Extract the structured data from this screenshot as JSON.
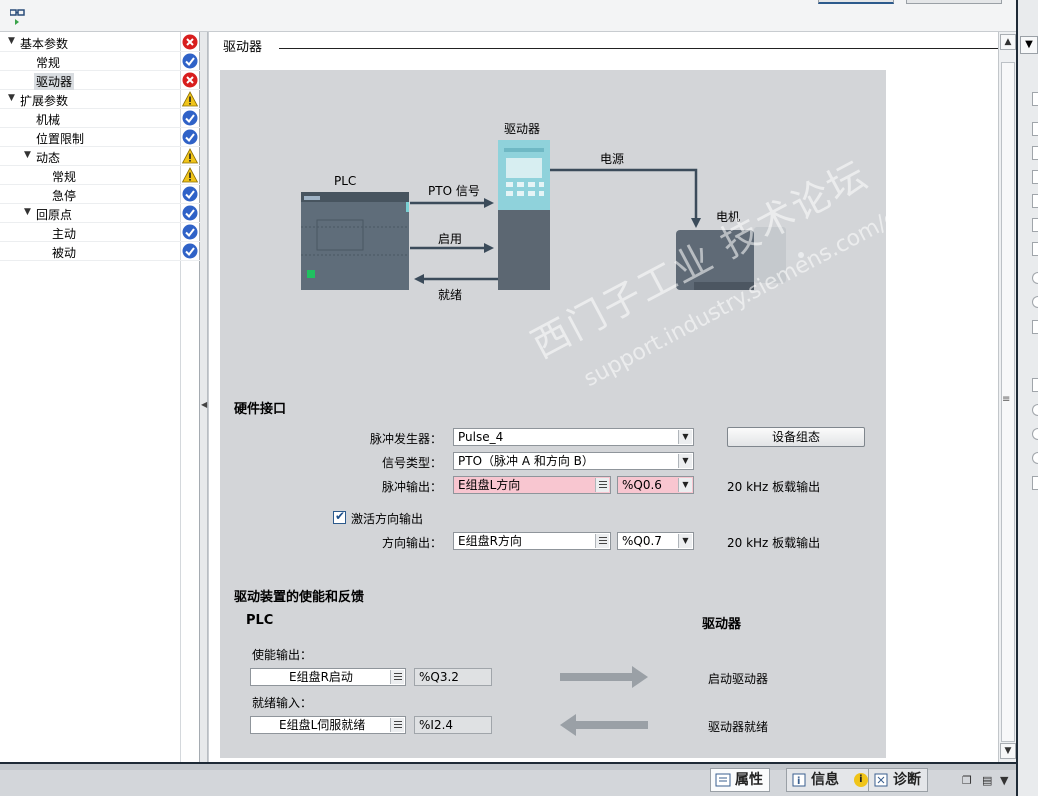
{
  "tree": {
    "items": [
      {
        "label": "基本参数",
        "status": "error"
      },
      {
        "label": "常规",
        "status": "ok"
      },
      {
        "label": "驱动器",
        "status": "error"
      },
      {
        "label": "扩展参数",
        "status": "warning"
      },
      {
        "label": "机械",
        "status": "ok"
      },
      {
        "label": "位置限制",
        "status": "ok"
      },
      {
        "label": "动态",
        "status": "warning"
      },
      {
        "label": "常规",
        "status": "warning"
      },
      {
        "label": "急停",
        "status": "ok"
      },
      {
        "label": "回原点",
        "status": "ok"
      },
      {
        "label": "主动",
        "status": "ok"
      },
      {
        "label": "被动",
        "status": "ok"
      }
    ]
  },
  "main": {
    "section_title": "驱动器"
  },
  "diagram": {
    "plc_label": "PLC",
    "drive_label": "驱动器",
    "power_label": "电源",
    "motor_label": "电机",
    "pto_label": "PTO 信号",
    "enable_label": "启用",
    "ready_label": "就绪"
  },
  "watermark": {
    "line1": "西门子工业  技术论坛",
    "line2": "support.industry.siemens.com/cs"
  },
  "hardware": {
    "heading": "硬件接口",
    "pulse_gen_label": "脉冲发生器：",
    "pulse_gen_value": "Pulse_4",
    "device_config_button": "设备组态",
    "signal_type_label": "信号类型：",
    "signal_type_value": "PTO（脉冲 A 和方向 B）",
    "pulse_out_label": "脉冲输出：",
    "pulse_out_tag": "E组盘L方向",
    "pulse_out_addr": "%Q0.6",
    "pulse_out_note": "20 kHz 板载输出",
    "activate_dir_label": "激活方向输出",
    "activate_dir_checked": true,
    "dir_out_label": "方向输出：",
    "dir_out_tag": "E组盘R方向",
    "dir_out_addr": "%Q0.7",
    "dir_out_note": "20 kHz 板载输出"
  },
  "enable_feedback": {
    "heading": "驱动装置的使能和反馈",
    "plc_col": "PLC",
    "drive_col": "驱动器",
    "enable_out_label": "使能输出：",
    "enable_out_tag": "E组盘R启动",
    "enable_out_addr": "%Q3.2",
    "enable_out_target": "启动驱动器",
    "ready_in_label": "就绪输入：",
    "ready_in_tag": "E组盘L伺服就绪",
    "ready_in_addr": "%I2.4",
    "ready_in_source": "驱动器就绪"
  },
  "bottom_tabs": [
    {
      "label": "属性",
      "icon": "properties-icon"
    },
    {
      "label": "信息",
      "icon": "info-icon"
    },
    {
      "label": "诊断",
      "icon": "diagnostics-icon"
    }
  ],
  "colors": {
    "error": "#d81e1e",
    "ok": "#2f62c7",
    "warning": "#f0c419",
    "panel": "#d3d5d8",
    "pink_field": "#f8c6d0"
  }
}
